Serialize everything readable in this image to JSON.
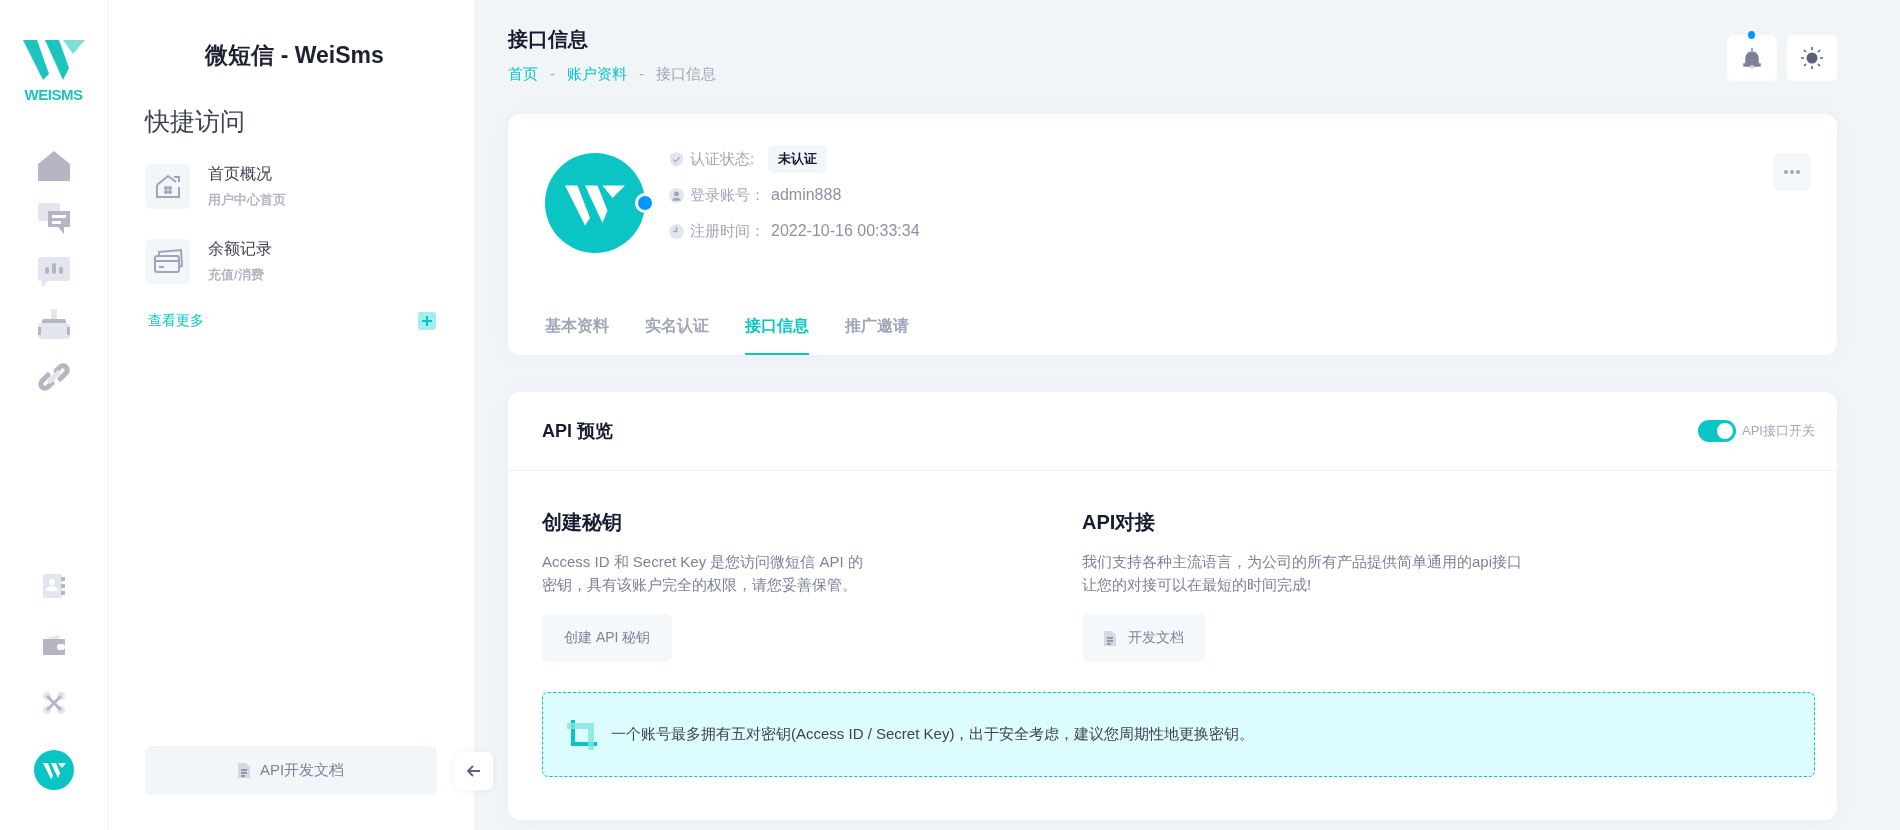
{
  "rail": {
    "logo_text": "WEISMS"
  },
  "quick_panel": {
    "brand": "微短信 - WeiSms",
    "title": "快捷访问",
    "items": [
      {
        "kind": "home",
        "label": "首页概况",
        "sub": "用户中心首页"
      },
      {
        "kind": "card",
        "label": "余额记录",
        "sub": "充值/消费"
      }
    ],
    "more_link": "查看更多",
    "docs_button": "API开发文档"
  },
  "header": {
    "title": "接口信息",
    "unread": true,
    "breadcrumb": [
      {
        "label": "首页",
        "link": true
      },
      {
        "label": "-",
        "link": false
      },
      {
        "label": "账户资料",
        "link": true
      },
      {
        "label": "-",
        "link": false
      },
      {
        "label": "接口信息",
        "link": false
      }
    ]
  },
  "profile": {
    "online": true,
    "fields": [
      {
        "kind": "badge",
        "label": "认证状态:",
        "value": "未认证"
      },
      {
        "kind": "text",
        "label": "登录账号：",
        "value": "admin888"
      },
      {
        "kind": "text",
        "label": "注册时间：",
        "value": "2022-10-16 00:33:34"
      }
    ],
    "tabs": [
      {
        "label": "基本资料",
        "selected": false
      },
      {
        "label": "实名认证",
        "selected": false
      },
      {
        "label": "接口信息",
        "selected": true
      },
      {
        "label": "推广邀请",
        "selected": false
      }
    ]
  },
  "api": {
    "title": "API 预览",
    "switch": {
      "label": "API接口开关",
      "on": true
    },
    "sections": [
      {
        "title": "创建秘钥",
        "lines": [
          "Access ID 和 Secret Key 是您访问微短信 API 的",
          "密钥，具有该账户完全的权限，请您妥善保管。"
        ],
        "button": "创建 API 秘钥",
        "button_icon": false
      },
      {
        "title": "API对接",
        "lines": [
          "我们支持各种主流语言，为公司的所有产品提供简单通用的api接口",
          "让您的对接可以在最短的时间完成!"
        ],
        "button": "开发文档",
        "button_icon": true
      }
    ],
    "notice": "一个账号最多拥有五对密钥(Access ID / Secret Key)，出于安全考虑，建议您周期性地更换密钥。"
  }
}
